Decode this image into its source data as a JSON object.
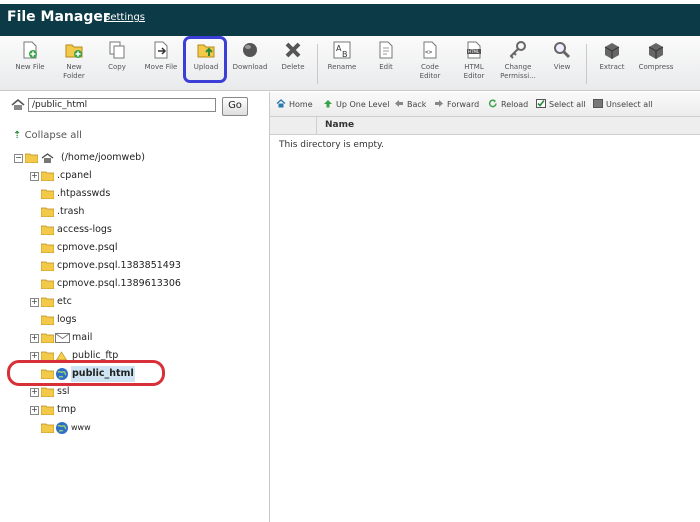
{
  "header": {
    "title": "File Manager",
    "settings": "Settings"
  },
  "toolbar": {
    "new_file": "New File",
    "new_folder": "New\nFolder",
    "copy": "Copy",
    "move_file": "Move File",
    "upload": "Upload",
    "download": "Download",
    "delete": "Delete",
    "rename": "Rename",
    "edit": "Edit",
    "code_editor": "Code\nEditor",
    "html_editor": "HTML\nEditor",
    "change_permissions": "Change\nPermissi...",
    "view": "View",
    "extract": "Extract",
    "compress": "Compress"
  },
  "path": {
    "value": "/public_html",
    "go": "Go"
  },
  "tree": {
    "collapse_all": "Collapse all",
    "root": "(/home/joomweb)",
    "items": [
      ".cpanel",
      ".htpasswds",
      ".trash",
      "access-logs",
      "cpmove.psql",
      "cpmove.psql.1383851493",
      "cpmove.psql.1389613306",
      "etc",
      "logs",
      "mail",
      "public_ftp",
      "public_html",
      "ssl",
      "tmp",
      "www"
    ]
  },
  "nav": {
    "home": "Home",
    "up": "Up One Level",
    "back": "Back",
    "forward": "Forward",
    "reload": "Reload",
    "select_all": "Select all",
    "unselect_all": "Unselect all"
  },
  "list": {
    "col_name": "Name",
    "empty": "This directory is empty."
  },
  "colors": {
    "header_bg": "#0c3a46",
    "upload_highlight": "#3b3fd8",
    "selected_highlight": "#d83038"
  }
}
